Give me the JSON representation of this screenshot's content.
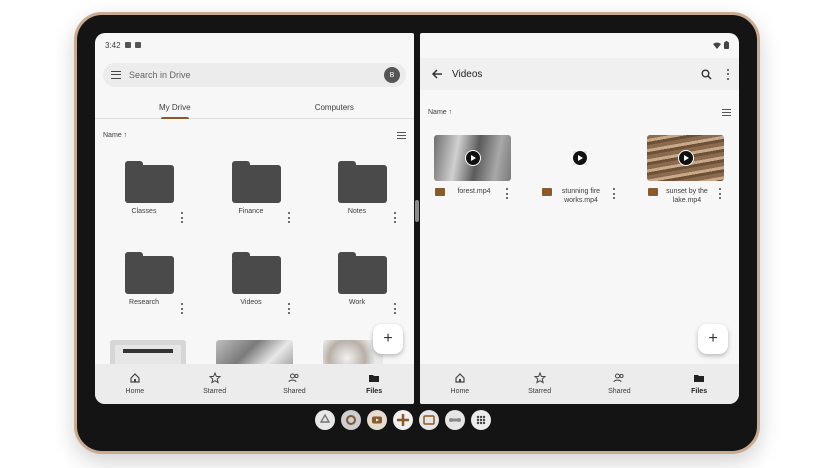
{
  "status": {
    "time": "3:42"
  },
  "left": {
    "search_placeholder": "Search in Drive",
    "avatar_letter": "B",
    "tabs": [
      {
        "label": "My Drive",
        "active": true
      },
      {
        "label": "Computers",
        "active": false
      }
    ],
    "sort_label": "Name ↑",
    "folders": [
      "Classes",
      "Finance",
      "Notes",
      "Research",
      "Videos",
      "Work"
    ],
    "fab": "+",
    "nav": [
      {
        "label": "Home"
      },
      {
        "label": "Starred"
      },
      {
        "label": "Shared"
      },
      {
        "label": "Files",
        "active": true
      }
    ]
  },
  "right": {
    "title": "Videos",
    "sort_label": "Name ↑",
    "videos": [
      {
        "label": "forest.mp4"
      },
      {
        "label": "stunning fire works.mp4"
      },
      {
        "label": "sunset by the lake.mp4"
      }
    ],
    "fab": "+",
    "nav": [
      {
        "label": "Home"
      },
      {
        "label": "Starred"
      },
      {
        "label": "Shared"
      },
      {
        "label": "Files",
        "active": true
      }
    ]
  },
  "colors": {
    "accent": "#8b5a2b",
    "folder": "#4a4a4a"
  },
  "icons": [
    "menu-icon",
    "search-icon",
    "more-vert-icon",
    "arrow-back-icon",
    "list-view-icon",
    "folder-icon",
    "video-file-icon",
    "play-icon",
    "home-icon",
    "star-icon",
    "people-icon",
    "folder-filled-icon",
    "add-icon"
  ]
}
